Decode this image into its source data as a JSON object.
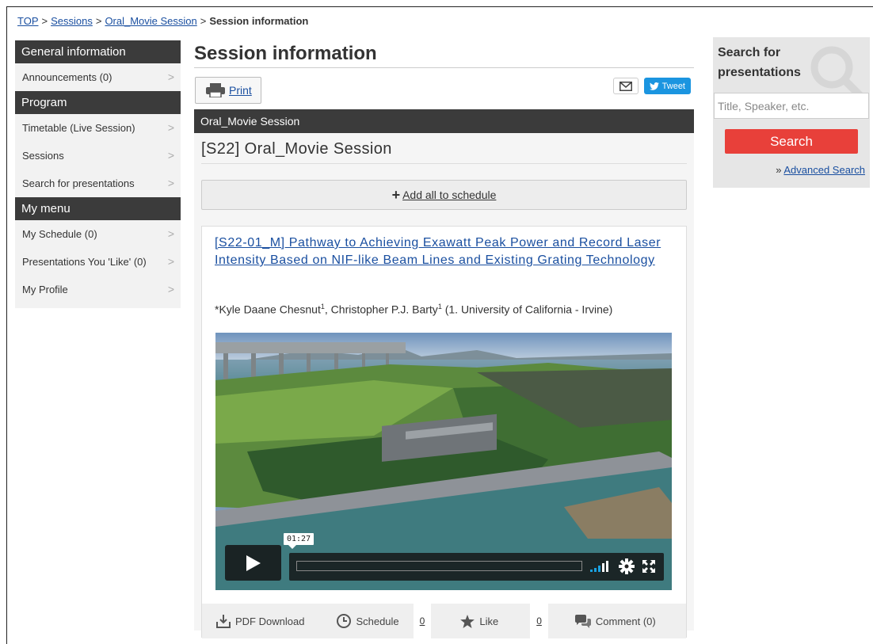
{
  "breadcrumb": {
    "top": "TOP",
    "sessions": "Sessions",
    "session": "Oral_Movie Session",
    "current": "Session information",
    "separator": ">"
  },
  "sidebar": {
    "general_header": "General information",
    "announcements": "Announcements (0)",
    "program_header": "Program",
    "timetable": "Timetable (Live Session)",
    "sessions": "Sessions",
    "search": "Search for presentations",
    "mymenu_header": "My menu",
    "my_schedule": "My Schedule (0)",
    "liked": "Presentations You 'Like' (0)",
    "profile": "My Profile",
    "chevron": ">"
  },
  "main": {
    "page_title": "Session information",
    "print_label": "Print",
    "tweet_label": "Tweet",
    "session_bar": "Oral_Movie Session",
    "session_title": "[S22] Oral_Movie Session",
    "add_all_label": "Add all to schedule",
    "presentation": {
      "title": "[S22-01_M] Pathway to Achieving Exawatt Peak Power and Record Laser Intensity Based on NIF-like Beam Lines and Existing Grating Technology",
      "author1": "*Kyle Daane Chesnut",
      "author2": ", Christopher P.J. Barty",
      "affil_num": "1",
      "affiliation": " (1. University of California - Irvine)",
      "video_time": "01:27",
      "pdf_label": "PDF Download",
      "schedule_label": "Schedule",
      "schedule_count": "0",
      "like_label": "Like",
      "like_count": "0",
      "comment_label": "Comment (0)"
    }
  },
  "search_panel": {
    "title": "Search for presentations",
    "placeholder": "Title, Speaker, etc.",
    "button": "Search",
    "adv_prefix": "» ",
    "adv_link": "Advanced Search"
  },
  "colors": {
    "dark_header": "#3b3b3b",
    "link": "#1a4fa0",
    "search_button": "#e8403a",
    "tweet": "#1b95e0"
  }
}
